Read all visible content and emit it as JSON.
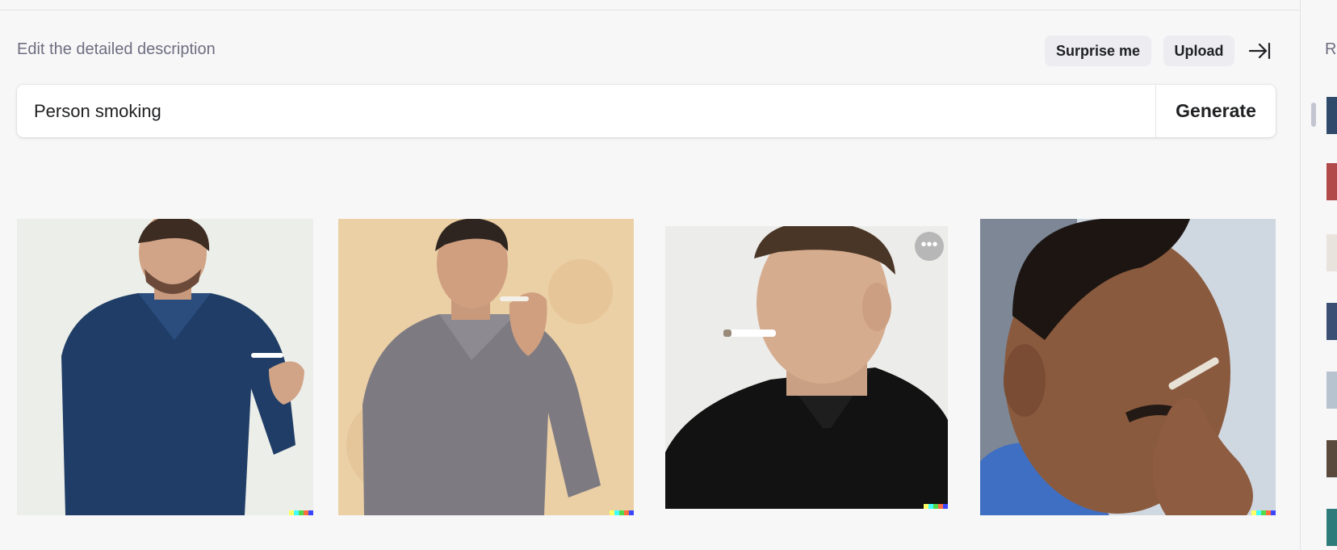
{
  "header": {
    "hint": "Edit the detailed description",
    "surprise_label": "Surprise me",
    "upload_label": "Upload"
  },
  "prompt": {
    "value": "Person smoking",
    "generate_label": "Generate"
  },
  "results": {
    "count": 4,
    "images": [
      {
        "name": "man-blue-shirt-holding-cigarette",
        "has_more_menu": false
      },
      {
        "name": "man-gray-shirt-holding-cigarette",
        "has_more_menu": false
      },
      {
        "name": "man-black-polo-cigarette-in-mouth",
        "has_more_menu": true
      },
      {
        "name": "man-blue-shirt-smoking-close-up",
        "has_more_menu": false
      }
    ],
    "more_menu_glyph": "•••",
    "watermark_colors": [
      "#ffff66",
      "#42ffff",
      "#51da4c",
      "#ff6e3c",
      "#3c46ff"
    ]
  },
  "right_rail": {
    "label": "R",
    "thumbnail_count": 8
  },
  "icons": {
    "collapse": "collapse-panel-icon",
    "more": "more-horizontal-icon"
  }
}
